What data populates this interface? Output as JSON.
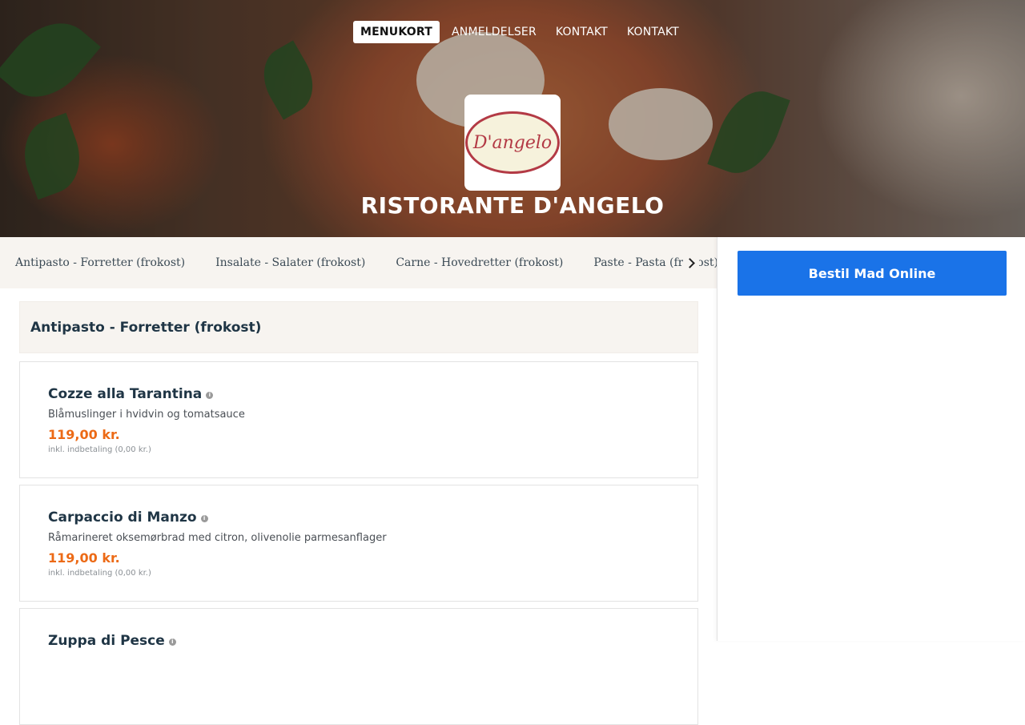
{
  "nav": [
    {
      "label": "MENUKORT",
      "active": true
    },
    {
      "label": "ANMELDELSER",
      "active": false
    },
    {
      "label": "KONTAKT",
      "active": false
    },
    {
      "label": "KONTAKT",
      "active": false
    }
  ],
  "restaurant": {
    "logo_text": "D'angelo",
    "name": "RISTORANTE D'ANGELO"
  },
  "categories": [
    "Antipasto - Forretter (frokost)",
    "Insalate - Salater (frokost)",
    "Carne - Hovedretter (frokost)",
    "Paste - Pasta (frokost)"
  ],
  "order_button": "Bestil Mad Online",
  "section": {
    "title": "Antipasto - Forretter (frokost)",
    "items": [
      {
        "name": "Cozze alla Tarantina",
        "desc": "Blåmuslinger i hvidvin og tomatsauce",
        "price": "119,00 kr.",
        "note": "inkl. indbetaling (0,00 kr.)"
      },
      {
        "name": "Carpaccio di Manzo",
        "desc": "Råmarineret oksemørbrad med citron, olivenolie parmesanflager",
        "price": "119,00 kr.",
        "note": "inkl. indbetaling (0,00 kr.)"
      },
      {
        "name": "Zuppa di Pesce",
        "desc": "",
        "price": "",
        "note": ""
      }
    ]
  },
  "colors": {
    "accent": "#1a73e8",
    "price": "#ec6a16",
    "heading": "#1f3545",
    "logo": "#b33a45"
  },
  "icons": {
    "info": "info-icon",
    "next": "chevron-right-icon"
  }
}
